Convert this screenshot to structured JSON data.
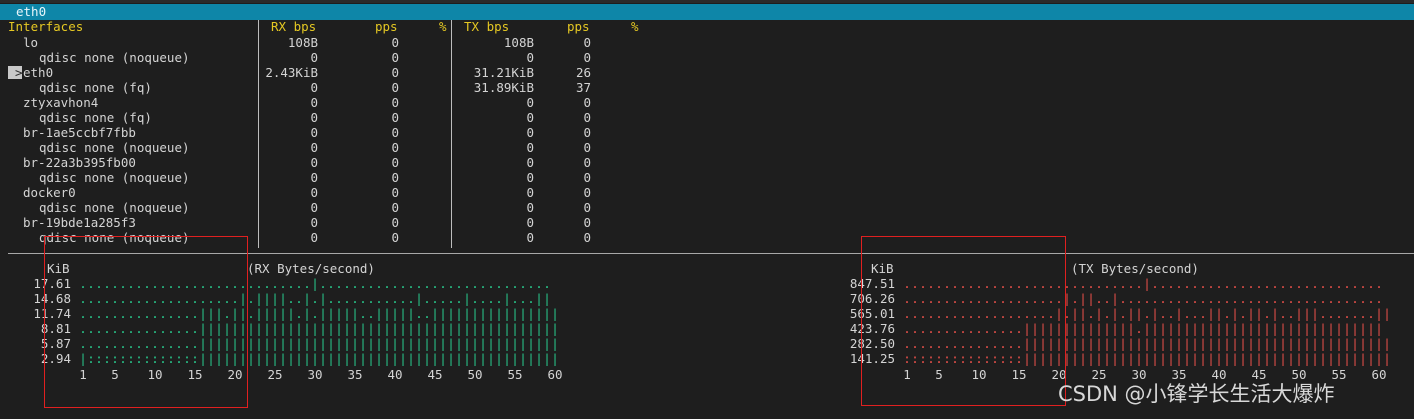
{
  "title": "eth0",
  "headers": {
    "interfaces": "Interfaces",
    "rx_bps": "RX bps",
    "rx_pps": "pps",
    "rx_pct": "%",
    "tx_bps": "TX bps",
    "tx_pps": "pps",
    "tx_pct": "%"
  },
  "rows": [
    {
      "name": "lo",
      "indent": 1,
      "rx_bps": "108B",
      "rx_pps": "0",
      "tx_bps": "108B",
      "tx_pps": "0",
      "selected": false
    },
    {
      "name": "qdisc none (noqueue)",
      "indent": 2,
      "rx_bps": "0",
      "rx_pps": "0",
      "tx_bps": "0",
      "tx_pps": "0",
      "selected": false
    },
    {
      "name": "eth0",
      "indent": 1,
      "rx_bps": "2.43KiB",
      "rx_pps": "0",
      "tx_bps": "31.21KiB",
      "tx_pps": "26",
      "selected": true
    },
    {
      "name": "qdisc none (fq)",
      "indent": 2,
      "rx_bps": "0",
      "rx_pps": "0",
      "tx_bps": "31.89KiB",
      "tx_pps": "37",
      "selected": false
    },
    {
      "name": "ztyxavhon4",
      "indent": 1,
      "rx_bps": "0",
      "rx_pps": "0",
      "tx_bps": "0",
      "tx_pps": "0",
      "selected": false
    },
    {
      "name": "qdisc none (fq)",
      "indent": 2,
      "rx_bps": "0",
      "rx_pps": "0",
      "tx_bps": "0",
      "tx_pps": "0",
      "selected": false
    },
    {
      "name": "br-1ae5ccbf7fbb",
      "indent": 1,
      "rx_bps": "0",
      "rx_pps": "0",
      "tx_bps": "0",
      "tx_pps": "0",
      "selected": false
    },
    {
      "name": "qdisc none (noqueue)",
      "indent": 2,
      "rx_bps": "0",
      "rx_pps": "0",
      "tx_bps": "0",
      "tx_pps": "0",
      "selected": false
    },
    {
      "name": "br-22a3b395fb00",
      "indent": 1,
      "rx_bps": "0",
      "rx_pps": "0",
      "tx_bps": "0",
      "tx_pps": "0",
      "selected": false
    },
    {
      "name": "qdisc none (noqueue)",
      "indent": 2,
      "rx_bps": "0",
      "rx_pps": "0",
      "tx_bps": "0",
      "tx_pps": "0",
      "selected": false
    },
    {
      "name": "docker0",
      "indent": 1,
      "rx_bps": "0",
      "rx_pps": "0",
      "tx_bps": "0",
      "tx_pps": "0",
      "selected": false
    },
    {
      "name": "qdisc none (noqueue)",
      "indent": 2,
      "rx_bps": "0",
      "rx_pps": "0",
      "tx_bps": "0",
      "tx_pps": "0",
      "selected": false
    },
    {
      "name": "br-19bde1a285f3",
      "indent": 1,
      "rx_bps": "0",
      "rx_pps": "0",
      "tx_bps": "0",
      "tx_pps": "0",
      "selected": false
    },
    {
      "name": "qdisc none (noqueue)",
      "indent": 2,
      "rx_bps": "0",
      "rx_pps": "0",
      "tx_bps": "0",
      "tx_pps": "0",
      "selected": false
    }
  ],
  "selection_marker": ">",
  "colors": {
    "title_bar": "#0e86a8",
    "header_text": "#e5c823",
    "rx_graph": "#28c88c",
    "tx_graph": "#e8504a",
    "highlight_box": "#e02020"
  },
  "graphs": [
    {
      "id": "rx",
      "unit": "KiB",
      "title": "(RX Bytes/second)",
      "y_labels": [
        "17.61",
        "14.68",
        "11.74",
        "8.81",
        "5.87",
        "2.94"
      ],
      "x_labels": [
        "1",
        "5",
        "10",
        "15",
        "20",
        "25",
        "30",
        "35",
        "40",
        "45",
        "50",
        "55",
        "60"
      ],
      "rows": [
        ".............................|.............................",
        "....................|.||||..|.|...........|.....|....|...||",
        "...............|||.||.|||||.|.|||||..|||||..||||||||||||||||",
        "...............|||||||||||||||||||||||||||||||||||||||||||||",
        "...............|||||||||||||||||||||||||||||||||||||||||||||",
        "|::::::::::::::|||||||||||||||||||||||||||||||||||||||||||||"
      ]
    },
    {
      "id": "tx",
      "unit": "KiB",
      "title": "(TX Bytes/second)",
      "y_labels": [
        "847.51",
        "706.26",
        "565.01",
        "423.76",
        "282.50",
        "141.25"
      ],
      "x_labels": [
        "1",
        "5",
        "10",
        "15",
        "20",
        "25",
        "30",
        "35",
        "40",
        "45",
        "50",
        "55",
        "60"
      ],
      "rows": [
        "..............................|.............................",
        "....................|.||..|.................................",
        "...................|.||.|.|.||.|..|...||.|.||.|..|||.......||",
        "...............||||||||||||||.||||||||||||||||||||||||||||||",
        "...............||||||||||||||||||||||||||||||||||||||||||||||",
        ":::::::::::::::||||||||||||||||||||||||||||||||||||||||||||||"
      ]
    }
  ],
  "watermark": "CSDN @小锋学长生活大爆炸"
}
